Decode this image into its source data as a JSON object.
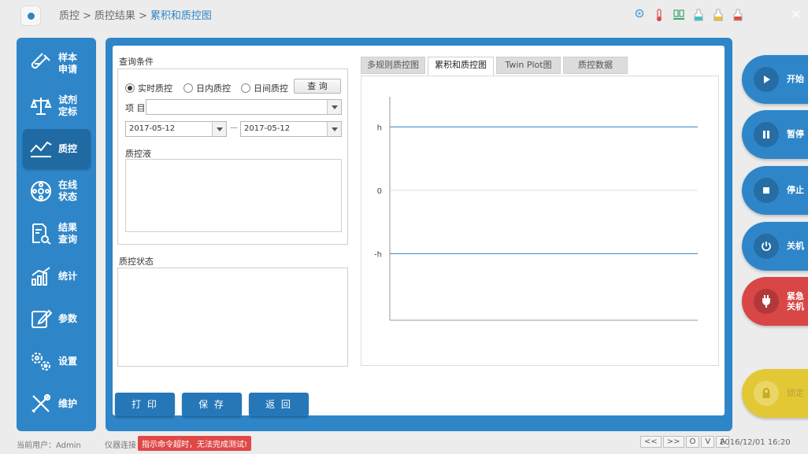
{
  "breadcrumb": {
    "item1": "质控",
    "item2": "质控结果",
    "current": "累积和质控图",
    "sep": ">"
  },
  "window": {
    "close": "×"
  },
  "status_icons": [
    "settings-dot-icon",
    "thermometer-icon",
    "usb-icon",
    "reagent-bottle-cyan-icon",
    "reagent-bottle-yellow-icon",
    "reagent-bottle-red-icon"
  ],
  "sidebar": {
    "items": [
      {
        "label": "样本申请",
        "icon": "test-tube-icon",
        "active": false
      },
      {
        "label": "试剂定标",
        "icon": "balance-scale-icon",
        "active": false
      },
      {
        "label": "质控",
        "icon": "line-chart-icon",
        "active": true
      },
      {
        "label": "在线状态",
        "icon": "rotor-icon",
        "active": false
      },
      {
        "label": "结果查询",
        "icon": "document-search-icon",
        "active": false
      },
      {
        "label": "统计",
        "icon": "bar-trend-icon",
        "active": false
      },
      {
        "label": "参数",
        "icon": "edit-icon",
        "active": false
      },
      {
        "label": "设置",
        "icon": "gears-icon",
        "active": false
      },
      {
        "label": "维护",
        "icon": "tools-icon",
        "active": false
      }
    ]
  },
  "query": {
    "title": "查询条件",
    "modes": [
      {
        "label": "实时质控",
        "checked": true
      },
      {
        "label": "日内质控",
        "checked": false
      },
      {
        "label": "日间质控",
        "checked": false
      }
    ],
    "query_button": "查 询",
    "item_label": "项 目",
    "item_value": "",
    "date_from": "2017-05-12",
    "date_to": "2017-05-12",
    "date_sep": "—",
    "liquid_label": "质控液"
  },
  "status_section": {
    "title": "质控状态"
  },
  "tabs": [
    {
      "label": "多规则质控图",
      "active": false
    },
    {
      "label": "累积和质控图",
      "active": true
    },
    {
      "label": "Twin Plot图",
      "active": false
    },
    {
      "label": "质控数据",
      "active": false
    }
  ],
  "chart_data": {
    "type": "line",
    "y_ticks": [
      "h",
      "0",
      "-h"
    ],
    "series": [
      {
        "values": [
          1,
          1
        ]
      },
      {
        "values": [
          -1,
          -1
        ]
      }
    ],
    "ylim": [
      -2.05,
      1.55
    ],
    "line_color": "#4a90c8",
    "grid_color": "#dddddd"
  },
  "actions": {
    "print": "打 印",
    "save": "保 存",
    "back": "返 回"
  },
  "controls": [
    {
      "label": "开始",
      "icon": "play-icon",
      "color": "#2e86c9"
    },
    {
      "label": "暂停",
      "icon": "pause-icon",
      "color": "#2e86c9"
    },
    {
      "label": "停止",
      "icon": "stop-icon",
      "color": "#2e86c9"
    },
    {
      "label": "关机",
      "icon": "power-icon",
      "color": "#2e86c9"
    },
    {
      "label": "紧急关机",
      "icon": "plug-icon",
      "color": "#d94646"
    },
    {
      "label": "锁定",
      "icon": "lock-icon",
      "color": "#e2c834"
    }
  ],
  "footer": {
    "user_label": "当前用户：Admin",
    "conn_label": "仪器连接：",
    "alert": "指示命令超时，无法完成测试!",
    "nav": [
      "<<",
      ">>",
      "O",
      "V",
      "A"
    ],
    "datetime": "2016/12/01 16:20"
  }
}
